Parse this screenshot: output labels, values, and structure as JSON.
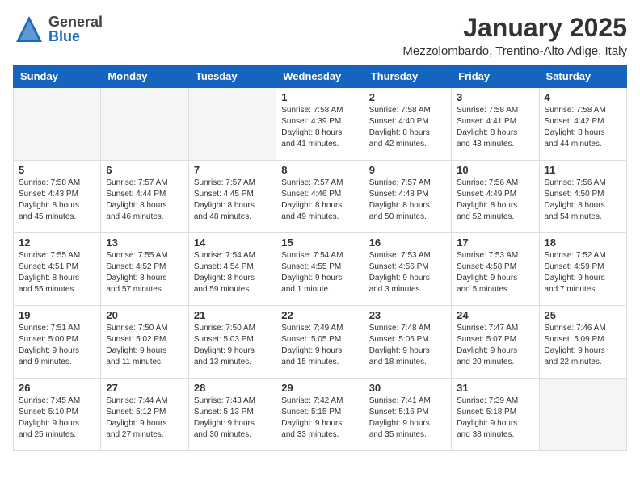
{
  "header": {
    "logo_general": "General",
    "logo_blue": "Blue",
    "month": "January 2025",
    "location": "Mezzolombardo, Trentino-Alto Adige, Italy"
  },
  "days_of_week": [
    "Sunday",
    "Monday",
    "Tuesday",
    "Wednesday",
    "Thursday",
    "Friday",
    "Saturday"
  ],
  "weeks": [
    [
      {
        "day": "",
        "info": ""
      },
      {
        "day": "",
        "info": ""
      },
      {
        "day": "",
        "info": ""
      },
      {
        "day": "1",
        "info": "Sunrise: 7:58 AM\nSunset: 4:39 PM\nDaylight: 8 hours\nand 41 minutes."
      },
      {
        "day": "2",
        "info": "Sunrise: 7:58 AM\nSunset: 4:40 PM\nDaylight: 8 hours\nand 42 minutes."
      },
      {
        "day": "3",
        "info": "Sunrise: 7:58 AM\nSunset: 4:41 PM\nDaylight: 8 hours\nand 43 minutes."
      },
      {
        "day": "4",
        "info": "Sunrise: 7:58 AM\nSunset: 4:42 PM\nDaylight: 8 hours\nand 44 minutes."
      }
    ],
    [
      {
        "day": "5",
        "info": "Sunrise: 7:58 AM\nSunset: 4:43 PM\nDaylight: 8 hours\nand 45 minutes."
      },
      {
        "day": "6",
        "info": "Sunrise: 7:57 AM\nSunset: 4:44 PM\nDaylight: 8 hours\nand 46 minutes."
      },
      {
        "day": "7",
        "info": "Sunrise: 7:57 AM\nSunset: 4:45 PM\nDaylight: 8 hours\nand 48 minutes."
      },
      {
        "day": "8",
        "info": "Sunrise: 7:57 AM\nSunset: 4:46 PM\nDaylight: 8 hours\nand 49 minutes."
      },
      {
        "day": "9",
        "info": "Sunrise: 7:57 AM\nSunset: 4:48 PM\nDaylight: 8 hours\nand 50 minutes."
      },
      {
        "day": "10",
        "info": "Sunrise: 7:56 AM\nSunset: 4:49 PM\nDaylight: 8 hours\nand 52 minutes."
      },
      {
        "day": "11",
        "info": "Sunrise: 7:56 AM\nSunset: 4:50 PM\nDaylight: 8 hours\nand 54 minutes."
      }
    ],
    [
      {
        "day": "12",
        "info": "Sunrise: 7:55 AM\nSunset: 4:51 PM\nDaylight: 8 hours\nand 55 minutes."
      },
      {
        "day": "13",
        "info": "Sunrise: 7:55 AM\nSunset: 4:52 PM\nDaylight: 8 hours\nand 57 minutes."
      },
      {
        "day": "14",
        "info": "Sunrise: 7:54 AM\nSunset: 4:54 PM\nDaylight: 8 hours\nand 59 minutes."
      },
      {
        "day": "15",
        "info": "Sunrise: 7:54 AM\nSunset: 4:55 PM\nDaylight: 9 hours\nand 1 minute."
      },
      {
        "day": "16",
        "info": "Sunrise: 7:53 AM\nSunset: 4:56 PM\nDaylight: 9 hours\nand 3 minutes."
      },
      {
        "day": "17",
        "info": "Sunrise: 7:53 AM\nSunset: 4:58 PM\nDaylight: 9 hours\nand 5 minutes."
      },
      {
        "day": "18",
        "info": "Sunrise: 7:52 AM\nSunset: 4:59 PM\nDaylight: 9 hours\nand 7 minutes."
      }
    ],
    [
      {
        "day": "19",
        "info": "Sunrise: 7:51 AM\nSunset: 5:00 PM\nDaylight: 9 hours\nand 9 minutes."
      },
      {
        "day": "20",
        "info": "Sunrise: 7:50 AM\nSunset: 5:02 PM\nDaylight: 9 hours\nand 11 minutes."
      },
      {
        "day": "21",
        "info": "Sunrise: 7:50 AM\nSunset: 5:03 PM\nDaylight: 9 hours\nand 13 minutes."
      },
      {
        "day": "22",
        "info": "Sunrise: 7:49 AM\nSunset: 5:05 PM\nDaylight: 9 hours\nand 15 minutes."
      },
      {
        "day": "23",
        "info": "Sunrise: 7:48 AM\nSunset: 5:06 PM\nDaylight: 9 hours\nand 18 minutes."
      },
      {
        "day": "24",
        "info": "Sunrise: 7:47 AM\nSunset: 5:07 PM\nDaylight: 9 hours\nand 20 minutes."
      },
      {
        "day": "25",
        "info": "Sunrise: 7:46 AM\nSunset: 5:09 PM\nDaylight: 9 hours\nand 22 minutes."
      }
    ],
    [
      {
        "day": "26",
        "info": "Sunrise: 7:45 AM\nSunset: 5:10 PM\nDaylight: 9 hours\nand 25 minutes."
      },
      {
        "day": "27",
        "info": "Sunrise: 7:44 AM\nSunset: 5:12 PM\nDaylight: 9 hours\nand 27 minutes."
      },
      {
        "day": "28",
        "info": "Sunrise: 7:43 AM\nSunset: 5:13 PM\nDaylight: 9 hours\nand 30 minutes."
      },
      {
        "day": "29",
        "info": "Sunrise: 7:42 AM\nSunset: 5:15 PM\nDaylight: 9 hours\nand 33 minutes."
      },
      {
        "day": "30",
        "info": "Sunrise: 7:41 AM\nSunset: 5:16 PM\nDaylight: 9 hours\nand 35 minutes."
      },
      {
        "day": "31",
        "info": "Sunrise: 7:39 AM\nSunset: 5:18 PM\nDaylight: 9 hours\nand 38 minutes."
      },
      {
        "day": "",
        "info": ""
      }
    ]
  ]
}
